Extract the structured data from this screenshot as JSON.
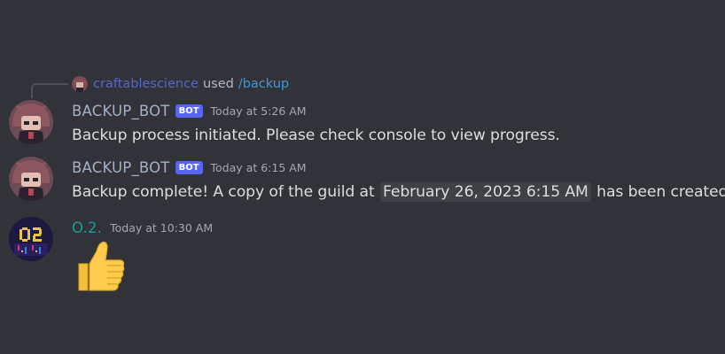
{
  "reply": {
    "user": "craftablescience",
    "used": "used",
    "command": "/backup"
  },
  "messages": [
    {
      "username": "BACKUP_BOT",
      "bot_tag": "BOT",
      "timestamp": "Today at 5:26 AM",
      "content": "Backup process initiated. Please check console to view progress."
    },
    {
      "username": "BACKUP_BOT",
      "bot_tag": "BOT",
      "timestamp": "Today at 6:15 AM",
      "content_prefix": "Backup complete! A copy of the guild at",
      "content_date": "February 26, 2023 6:15 AM",
      "content_suffix": "has been created."
    },
    {
      "username": "O.2.",
      "timestamp": "Today at 10:30 AM",
      "emoji": "thumbs-up"
    }
  ],
  "colors": {
    "background": "#313338",
    "bot_tag": "#5865f2",
    "bot_username": "#a4b0c7",
    "o2_username": "#1a9a9a",
    "command": "#3a98d9"
  }
}
